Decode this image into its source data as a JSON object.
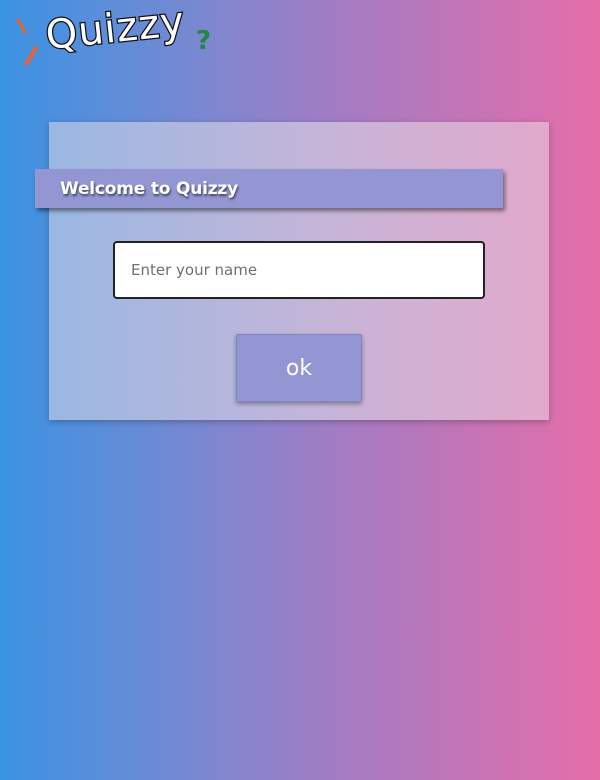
{
  "logo": {
    "text": "Quizzy",
    "mark": "?"
  },
  "card": {
    "title": "Welcome to Quizzy",
    "name_input": {
      "placeholder": "Enter your name",
      "value": ""
    },
    "ok_button": {
      "label": "ok"
    }
  },
  "colors": {
    "bg_left": "#3a93e3",
    "bg_right": "#e56ea9",
    "banner": "#9396d2",
    "button": "#9396d2",
    "logo_accent": "#e8623a",
    "logo_question": "#1f8a3f"
  }
}
